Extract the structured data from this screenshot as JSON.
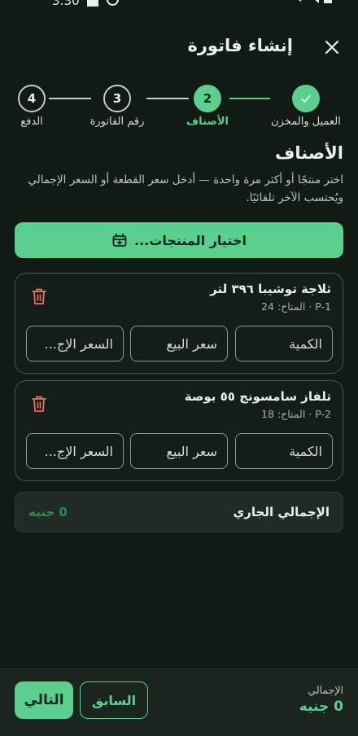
{
  "status_bar": {
    "time": "3:30"
  },
  "header": {
    "title": "إنشاء فاتورة"
  },
  "stepper": {
    "steps": [
      {
        "label": "العميل والمخزن",
        "number": "1",
        "state": "done"
      },
      {
        "label": "الأصناف",
        "number": "2",
        "state": "active"
      },
      {
        "label": "رقم الفاتورة",
        "number": "3",
        "state": "pending"
      },
      {
        "label": "الدفع",
        "number": "4",
        "state": "pending"
      }
    ]
  },
  "section": {
    "title": "الأصناف",
    "description": "اختر منتجًا أو أكثر مرة واحدة — أدخل سعر القطعة أو السعر الإجمالي ويُحتسب الآخر تلقائيًا."
  },
  "pick_button": {
    "label": "اختيار المنتجات..."
  },
  "items": [
    {
      "name": "ثلاجة توشيبا ٣٩٦ لتر",
      "meta": "P-1 · المتاح: 24",
      "quantity_placeholder": "الكمية",
      "sale_price_placeholder": "سعر البيع",
      "total_price_placeholder": "السعر الإج..."
    },
    {
      "name": "تلفاز سامسونج ٥٥ بوصة",
      "meta": "P-2 · المتاح: 18",
      "quantity_placeholder": "الكمية",
      "sale_price_placeholder": "سعر البيع",
      "total_price_placeholder": "السعر الإج..."
    }
  ],
  "running_total": {
    "label": "الإجمالي الجاري",
    "value": "0 جنيه"
  },
  "footer": {
    "total_caption": "الإجمالي",
    "total_value": "0 جنيه",
    "prev_label": "السابق",
    "next_label": "التالي"
  },
  "colors": {
    "accent": "#5bcf8e",
    "background": "#121a16",
    "danger": "#e5736b"
  }
}
